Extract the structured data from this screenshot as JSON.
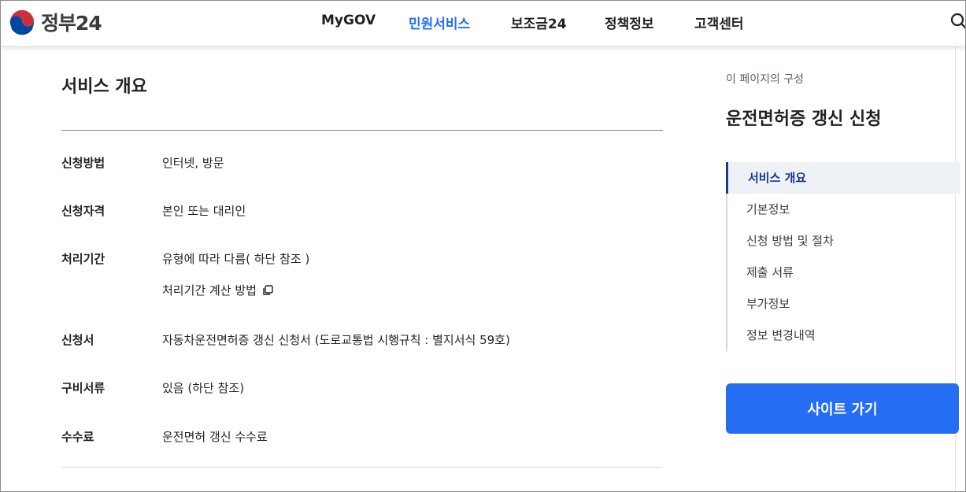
{
  "header": {
    "logo_text": "정부24",
    "nav": [
      {
        "label": "MyGOV"
      },
      {
        "label": "민원서비스"
      },
      {
        "label": "보조금24"
      },
      {
        "label": "정책정보"
      },
      {
        "label": "고객센터"
      }
    ],
    "active_nav": "민원서비스",
    "accent_color": "#256ef4"
  },
  "main": {
    "section_title": "서비스 개요",
    "rows": [
      {
        "label": "신청방법",
        "value": "인터넷, 방문"
      },
      {
        "label": "신청자격",
        "value": "본인 또는 대리인"
      },
      {
        "label": "처리기간",
        "value": "유형에 따라 다름( 하단 참조 )",
        "link": "처리기간 계산 방법"
      },
      {
        "label": "신청서",
        "value": "자동차운전면허증 갱신 신청서 (도로교통법 시행규칙 : 별지서식 59호)"
      },
      {
        "label": "구비서류",
        "value": "있음 (하단 참조)"
      },
      {
        "label": "수수료",
        "value": "운전면허 갱신 수수료"
      }
    ]
  },
  "side": {
    "caption": "이 페이지의 구성",
    "title": "운전면허증 갱신 신청",
    "toc": [
      {
        "label": "서비스 개요"
      },
      {
        "label": "기본정보"
      },
      {
        "label": "신청 방법 및 절차"
      },
      {
        "label": "제출 서류"
      },
      {
        "label": "부가정보"
      },
      {
        "label": "정보 변경내역"
      }
    ],
    "active_toc": "서비스 개요",
    "button_label": "사이트 가기"
  },
  "icons": {
    "logo": "taegeuk-logo-icon",
    "search": "search-icon",
    "copy": "copy-icon"
  }
}
